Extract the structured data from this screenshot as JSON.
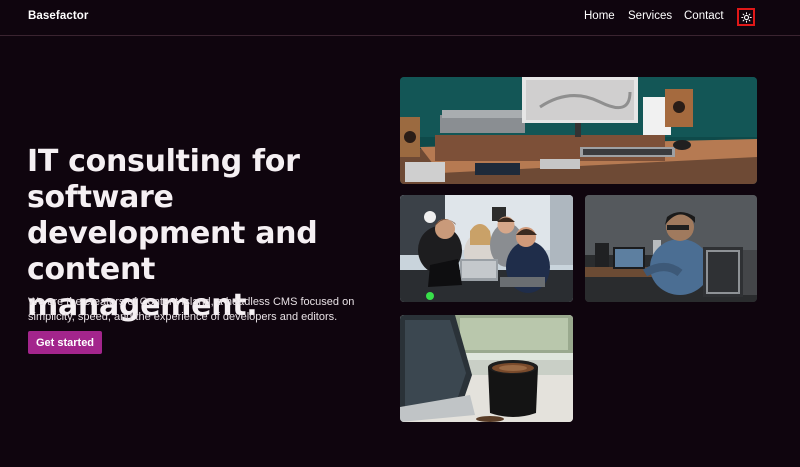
{
  "header": {
    "brand": "Basefactor",
    "nav": [
      {
        "label": "Home"
      },
      {
        "label": "Services"
      },
      {
        "label": "Contact"
      }
    ],
    "theme_toggle_icon": "sun-icon",
    "theme_toggle_highlight": "#e01818"
  },
  "hero": {
    "title": "IT consulting for software development and content management.",
    "description": "We are the creators of Content Island, a headless CMS focused on simplicity, speed, and the experience of developers and editors.",
    "cta_label": "Get started",
    "cta_color": "#a3258c"
  },
  "gallery": [
    {
      "subject": "desk-setup-photo"
    },
    {
      "subject": "team-meeting-photo"
    },
    {
      "subject": "person-at-laptop-photo"
    },
    {
      "subject": "coffee-cup-photo"
    }
  ],
  "colors": {
    "background": "#0f050e",
    "divider": "#3a2430"
  }
}
